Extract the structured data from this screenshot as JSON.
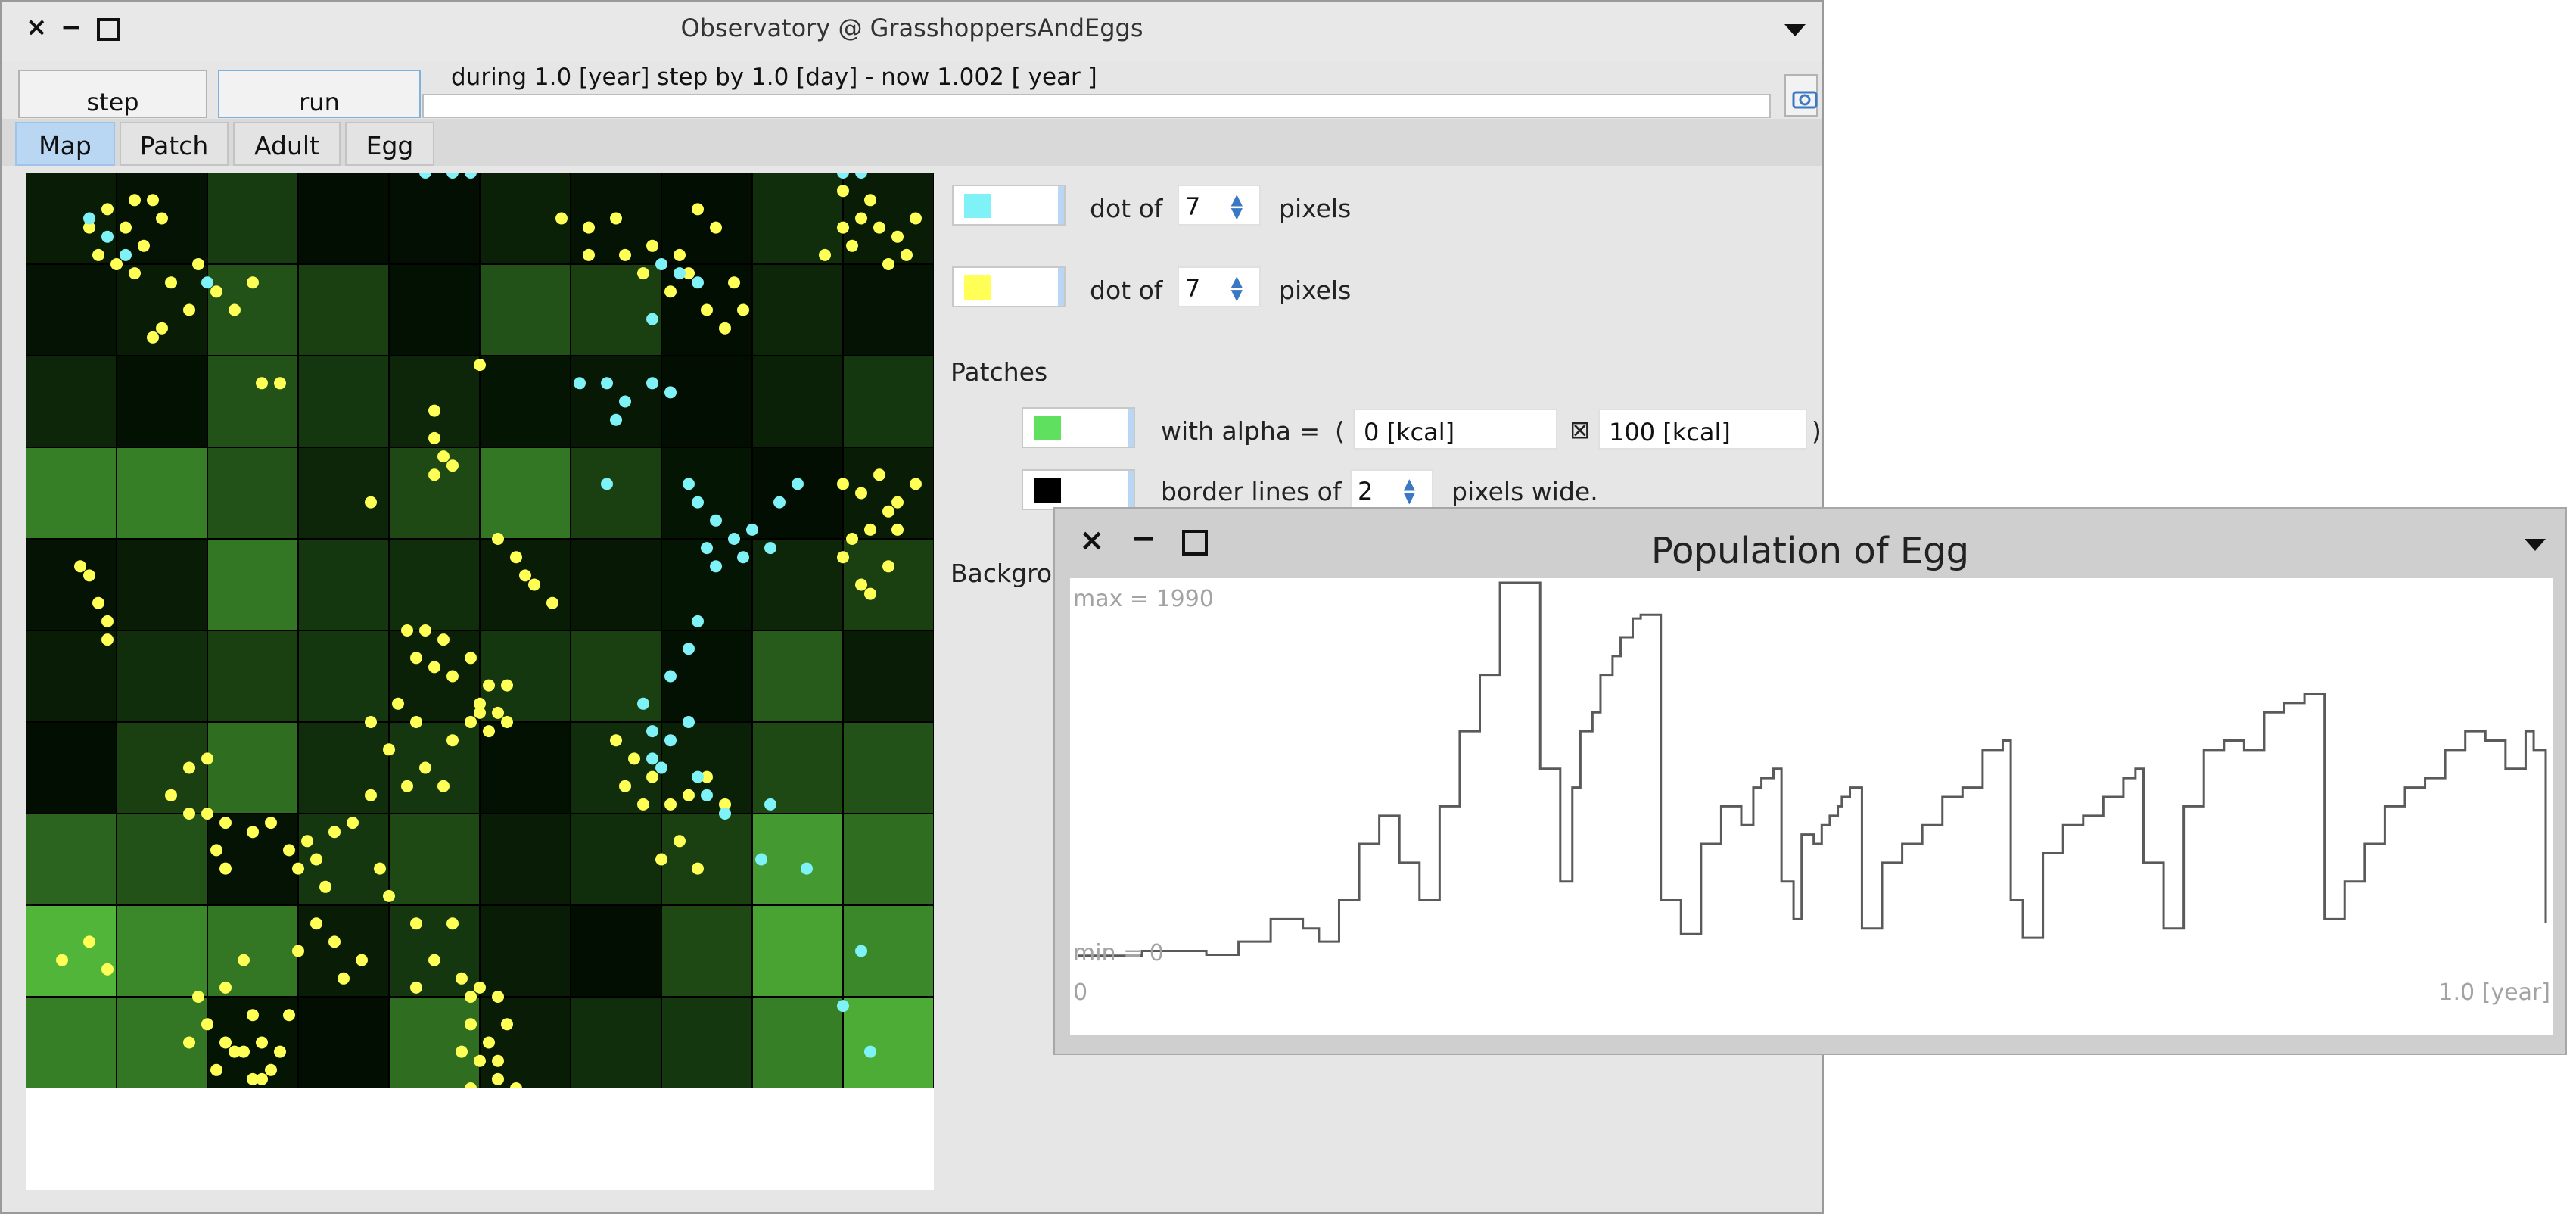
{
  "main_window": {
    "title": "Observatory @ GrasshoppersAndEggs",
    "close_glyph": "×",
    "minimize_glyph": "−",
    "step_label": "step",
    "run_label": "run",
    "status_text": "during 1.0 [year] step by 1.0 [day] - now 1.002 [ year ]",
    "tabs": [
      {
        "label": "Map",
        "active": true
      },
      {
        "label": "Patch",
        "active": false
      },
      {
        "label": "Adult",
        "active": false
      },
      {
        "label": "Egg",
        "active": false
      }
    ]
  },
  "settings": {
    "egg_dot": {
      "color": "#7ef2f7",
      "label": "dot of",
      "value": "7",
      "unit": "pixels"
    },
    "adult_dot": {
      "color": "#ffff55",
      "label": "dot of",
      "value": "7",
      "unit": "pixels"
    },
    "patches_heading": "Patches",
    "patch_color": "#5fe05f",
    "alpha_label": "with alpha =",
    "open_paren": "(",
    "alpha_min": "0 [kcal]",
    "range_symbol": "⊠",
    "alpha_max": "100 [kcal]",
    "close_paren": ")",
    "border_color": "#000000",
    "border_label": "border lines of",
    "border_value": "2",
    "border_unit": "pixels wide.",
    "background_heading": "Backgro"
  },
  "map": {
    "patch_levels": [
      [
        0.1,
        0.05,
        0.28,
        0.02,
        0.03,
        0.12,
        0.05,
        0.02,
        0.2,
        0.1
      ],
      [
        0.05,
        0.1,
        0.4,
        0.3,
        0.04,
        0.4,
        0.3,
        0.02,
        0.15,
        0.05
      ],
      [
        0.15,
        0.04,
        0.4,
        0.25,
        0.15,
        0.06,
        0.08,
        0.02,
        0.12,
        0.25
      ],
      [
        0.65,
        0.65,
        0.4,
        0.15,
        0.35,
        0.6,
        0.3,
        0.06,
        0.02,
        0.1
      ],
      [
        0.05,
        0.1,
        0.6,
        0.25,
        0.2,
        0.1,
        0.08,
        0.06,
        0.15,
        0.3
      ],
      [
        0.1,
        0.2,
        0.3,
        0.25,
        0.12,
        0.25,
        0.3,
        0.04,
        0.45,
        0.1
      ],
      [
        0.02,
        0.3,
        0.55,
        0.2,
        0.25,
        0.04,
        0.2,
        0.12,
        0.35,
        0.4
      ],
      [
        0.5,
        0.4,
        0.05,
        0.25,
        0.35,
        0.1,
        0.2,
        0.3,
        0.8,
        0.55
      ],
      [
        0.95,
        0.7,
        0.6,
        0.1,
        0.25,
        0.1,
        0.02,
        0.35,
        0.85,
        0.7
      ],
      [
        0.65,
        0.6,
        0.06,
        0.02,
        0.55,
        0.1,
        0.2,
        0.25,
        0.65,
        0.9
      ]
    ],
    "adult_dots": [
      [
        0.9,
        0.4
      ],
      [
        1.1,
        0.6
      ],
      [
        1.2,
        0.3
      ],
      [
        0.8,
        0.9
      ],
      [
        1.3,
        0.8
      ],
      [
        1.0,
        1.0
      ],
      [
        1.5,
        0.5
      ],
      [
        0.7,
        0.6
      ],
      [
        1.4,
        0.3
      ],
      [
        1.2,
        1.1
      ],
      [
        1.6,
        1.2
      ],
      [
        1.9,
        1.0
      ],
      [
        2.1,
        1.3
      ],
      [
        1.8,
        1.5
      ],
      [
        1.5,
        1.7
      ],
      [
        2.3,
        1.5
      ],
      [
        2.5,
        1.2
      ],
      [
        1.4,
        1.8
      ],
      [
        5.9,
        0.5
      ],
      [
        6.2,
        0.6
      ],
      [
        6.5,
        0.5
      ],
      [
        6.6,
        0.9
      ],
      [
        6.9,
        0.8
      ],
      [
        7.2,
        0.9
      ],
      [
        7.4,
        0.4
      ],
      [
        7.6,
        0.6
      ],
      [
        7.3,
        1.1
      ],
      [
        7.8,
        1.2
      ],
      [
        7.9,
        1.5
      ],
      [
        6.2,
        0.9
      ],
      [
        6.8,
        1.1
      ],
      [
        7.1,
        1.3
      ],
      [
        7.5,
        1.5
      ],
      [
        7.7,
        1.7
      ],
      [
        9.0,
        0.2
      ],
      [
        9.2,
        0.5
      ],
      [
        9.4,
        0.6
      ],
      [
        9.1,
        0.8
      ],
      [
        8.8,
        0.9
      ],
      [
        9.6,
        0.7
      ],
      [
        9.8,
        0.5
      ],
      [
        9.5,
        1.0
      ],
      [
        9.7,
        0.9
      ],
      [
        9.0,
        0.6
      ],
      [
        9.3,
        0.3
      ],
      [
        2.6,
        2.3
      ],
      [
        2.8,
        2.3
      ],
      [
        4.5,
        2.6
      ],
      [
        4.5,
        2.9
      ],
      [
        4.6,
        3.1
      ],
      [
        4.5,
        3.3
      ],
      [
        4.7,
        3.2
      ],
      [
        5.0,
        2.1
      ],
      [
        3.8,
        3.6
      ],
      [
        5.2,
        4.0
      ],
      [
        5.4,
        4.2
      ],
      [
        5.5,
        4.4
      ],
      [
        5.6,
        4.5
      ],
      [
        5.8,
        4.7
      ],
      [
        0.6,
        4.3
      ],
      [
        0.7,
        4.4
      ],
      [
        0.8,
        4.7
      ],
      [
        0.9,
        4.9
      ],
      [
        0.9,
        5.1
      ],
      [
        9.0,
        3.4
      ],
      [
        9.2,
        3.5
      ],
      [
        9.4,
        3.3
      ],
      [
        9.5,
        3.7
      ],
      [
        9.3,
        3.9
      ],
      [
        9.6,
        3.9
      ],
      [
        9.1,
        4.0
      ],
      [
        9.5,
        4.3
      ],
      [
        9.2,
        4.5
      ],
      [
        9.3,
        4.6
      ],
      [
        9.8,
        3.4
      ],
      [
        9.6,
        3.6
      ],
      [
        9.0,
        4.2
      ],
      [
        4.2,
        5.0
      ],
      [
        4.4,
        5.0
      ],
      [
        4.6,
        5.1
      ],
      [
        4.3,
        5.3
      ],
      [
        4.5,
        5.4
      ],
      [
        4.7,
        5.5
      ],
      [
        4.9,
        5.3
      ],
      [
        5.1,
        5.6
      ],
      [
        5.3,
        5.6
      ],
      [
        5.0,
        5.8
      ],
      [
        4.9,
        6.0
      ],
      [
        4.7,
        6.2
      ],
      [
        5.1,
        6.1
      ],
      [
        5.3,
        6.0
      ],
      [
        5.2,
        5.9
      ],
      [
        5.0,
        5.9
      ],
      [
        4.1,
        5.8
      ],
      [
        4.3,
        6.0
      ],
      [
        3.8,
        6.0
      ],
      [
        4.0,
        6.3
      ],
      [
        4.4,
        6.5
      ],
      [
        4.2,
        6.7
      ],
      [
        4.6,
        6.7
      ],
      [
        1.8,
        6.5
      ],
      [
        2.0,
        6.4
      ],
      [
        1.6,
        6.8
      ],
      [
        1.8,
        7.0
      ],
      [
        2.0,
        7.0
      ],
      [
        2.2,
        7.1
      ],
      [
        2.1,
        7.4
      ],
      [
        2.2,
        7.6
      ],
      [
        2.5,
        7.2
      ],
      [
        2.7,
        7.1
      ],
      [
        2.9,
        7.4
      ],
      [
        3.0,
        7.6
      ],
      [
        3.2,
        7.5
      ],
      [
        3.3,
        7.8
      ],
      [
        3.6,
        7.1
      ],
      [
        3.1,
        7.3
      ],
      [
        3.4,
        7.2
      ],
      [
        3.8,
        6.8
      ],
      [
        3.9,
        7.6
      ],
      [
        4.0,
        7.9
      ],
      [
        4.3,
        8.2
      ],
      [
        4.5,
        8.6
      ],
      [
        4.3,
        8.9
      ],
      [
        4.7,
        8.2
      ],
      [
        6.5,
        6.2
      ],
      [
        6.7,
        6.4
      ],
      [
        6.9,
        6.6
      ],
      [
        7.1,
        6.9
      ],
      [
        7.3,
        6.8
      ],
      [
        7.5,
        6.6
      ],
      [
        7.7,
        6.9
      ],
      [
        7.2,
        7.3
      ],
      [
        7.0,
        7.5
      ],
      [
        7.4,
        7.6
      ],
      [
        6.8,
        6.9
      ],
      [
        6.6,
        6.7
      ],
      [
        3.2,
        8.2
      ],
      [
        3.4,
        8.4
      ],
      [
        3.0,
        8.5
      ],
      [
        3.7,
        8.6
      ],
      [
        3.5,
        8.8
      ],
      [
        0.4,
        8.6
      ],
      [
        0.7,
        8.4
      ],
      [
        0.9,
        8.7
      ],
      [
        2.4,
        8.6
      ],
      [
        2.2,
        8.9
      ],
      [
        2.5,
        9.2
      ],
      [
        1.9,
        9.0
      ],
      [
        2.0,
        9.3
      ],
      [
        1.8,
        9.5
      ],
      [
        2.2,
        9.5
      ],
      [
        2.4,
        9.6
      ],
      [
        2.6,
        9.5
      ],
      [
        2.9,
        9.2
      ],
      [
        2.7,
        9.8
      ],
      [
        2.5,
        9.9
      ],
      [
        2.3,
        9.6
      ],
      [
        2.1,
        9.8
      ],
      [
        2.8,
        9.6
      ],
      [
        2.6,
        9.9
      ],
      [
        4.8,
        8.8
      ],
      [
        4.9,
        9.0
      ],
      [
        4.9,
        9.3
      ],
      [
        5.1,
        9.5
      ],
      [
        5.0,
        9.7
      ],
      [
        5.2,
        9.9
      ],
      [
        4.8,
        9.6
      ],
      [
        5.3,
        9.3
      ],
      [
        5.2,
        9.0
      ],
      [
        5.0,
        8.9
      ],
      [
        4.9,
        10.0
      ],
      [
        5.4,
        10.0
      ],
      [
        5.1,
        10.3
      ],
      [
        5.3,
        10.4
      ],
      [
        5.5,
        10.1
      ],
      [
        5.2,
        9.7
      ],
      [
        5.5,
        10.9
      ],
      [
        5.7,
        10.9
      ],
      [
        5.9,
        10.9
      ],
      [
        6.2,
        10.9
      ],
      [
        8.8,
        10.9
      ],
      [
        9.0,
        10.9
      ],
      [
        9.3,
        10.9
      ],
      [
        9.6,
        10.9
      ],
      [
        8.9,
        10.7
      ]
    ],
    "egg_dots": [
      [
        0.7,
        0.5
      ],
      [
        0.9,
        0.7
      ],
      [
        1.1,
        0.9
      ],
      [
        4.4,
        0.0
      ],
      [
        4.7,
        0.0
      ],
      [
        4.9,
        0.0
      ],
      [
        9.0,
        0.0
      ],
      [
        9.2,
        0.0
      ],
      [
        2.0,
        1.2
      ],
      [
        7.0,
        1.0
      ],
      [
        7.2,
        1.1
      ],
      [
        7.4,
        1.2
      ],
      [
        6.9,
        1.6
      ],
      [
        6.1,
        2.3
      ],
      [
        6.4,
        2.3
      ],
      [
        6.6,
        2.5
      ],
      [
        6.9,
        2.3
      ],
      [
        7.1,
        2.4
      ],
      [
        6.5,
        2.7
      ],
      [
        6.4,
        3.4
      ],
      [
        7.4,
        3.6
      ],
      [
        7.6,
        3.8
      ],
      [
        7.8,
        4.0
      ],
      [
        7.5,
        4.1
      ],
      [
        7.9,
        4.2
      ],
      [
        8.0,
        3.9
      ],
      [
        8.2,
        4.1
      ],
      [
        7.3,
        3.4
      ],
      [
        7.6,
        4.3
      ],
      [
        8.5,
        3.4
      ],
      [
        8.3,
        3.6
      ],
      [
        10.1,
        3.1
      ],
      [
        10.1,
        3.4
      ],
      [
        7.4,
        4.9
      ],
      [
        7.3,
        5.2
      ],
      [
        7.1,
        5.5
      ],
      [
        6.8,
        5.8
      ],
      [
        6.9,
        6.1
      ],
      [
        7.1,
        6.2
      ],
      [
        7.3,
        6.0
      ],
      [
        7.0,
        6.5
      ],
      [
        7.5,
        6.8
      ],
      [
        7.7,
        7.0
      ],
      [
        8.2,
        6.9
      ],
      [
        7.4,
        6.6
      ],
      [
        6.9,
        6.4
      ],
      [
        8.1,
        7.5
      ],
      [
        8.6,
        7.6
      ],
      [
        9.2,
        8.5
      ],
      [
        9.0,
        9.1
      ],
      [
        9.3,
        9.6
      ]
    ]
  },
  "population": {
    "title": "Population of Egg",
    "max_label": "max = 1990",
    "min_label": "min = 0",
    "x_start_label": "0",
    "x_end_label": "1.0 [year]"
  },
  "chart_data": {
    "type": "line",
    "title": "Population of Egg",
    "xlabel": "",
    "ylabel": "",
    "xlim": [
      0,
      365
    ],
    "ylim": [
      0,
      1990
    ],
    "x_tick_labels": [
      "0",
      "1.0 [year]"
    ],
    "y_labels": [
      "min = 0",
      "max = 1990"
    ],
    "grid": false,
    "series": [
      {
        "color": "#5a5a5a",
        "x": [
          0,
          16,
          32,
          40,
          48,
          56,
          60,
          65,
          70,
          75,
          80,
          85,
          90,
          95,
          100,
          105,
          110,
          115,
          120,
          123,
          125,
          128,
          130,
          133,
          135,
          138,
          140,
          145,
          150,
          155,
          160,
          165,
          168,
          170,
          173,
          175,
          178,
          180,
          183,
          185,
          187,
          189,
          190,
          192,
          195,
          200,
          205,
          210,
          215,
          220,
          225,
          230,
          232,
          235,
          240,
          245,
          250,
          255,
          260,
          263,
          265,
          270,
          275,
          280,
          285,
          290,
          295,
          300,
          305,
          310,
          315,
          320,
          325,
          330,
          335,
          340,
          345,
          350,
          355,
          360,
          362,
          365
        ],
        "y": [
          5,
          30,
          10,
          80,
          200,
          150,
          80,
          300,
          600,
          750,
          500,
          300,
          800,
          1200,
          1500,
          1990,
          1990,
          1000,
          400,
          900,
          1200,
          1300,
          1500,
          1600,
          1700,
          1800,
          1820,
          300,
          120,
          600,
          800,
          700,
          900,
          950,
          1000,
          400,
          200,
          650,
          600,
          700,
          750,
          800,
          850,
          900,
          150,
          500,
          600,
          700,
          850,
          900,
          1100,
          1150,
          300,
          100,
          550,
          700,
          750,
          850,
          950,
          1000,
          500,
          150,
          800,
          1100,
          1150,
          1100,
          1300,
          1350,
          1400,
          200,
          400,
          600,
          800,
          900,
          950,
          1100,
          1200,
          1150,
          1000,
          1200,
          1100,
          180
        ]
      }
    ]
  }
}
